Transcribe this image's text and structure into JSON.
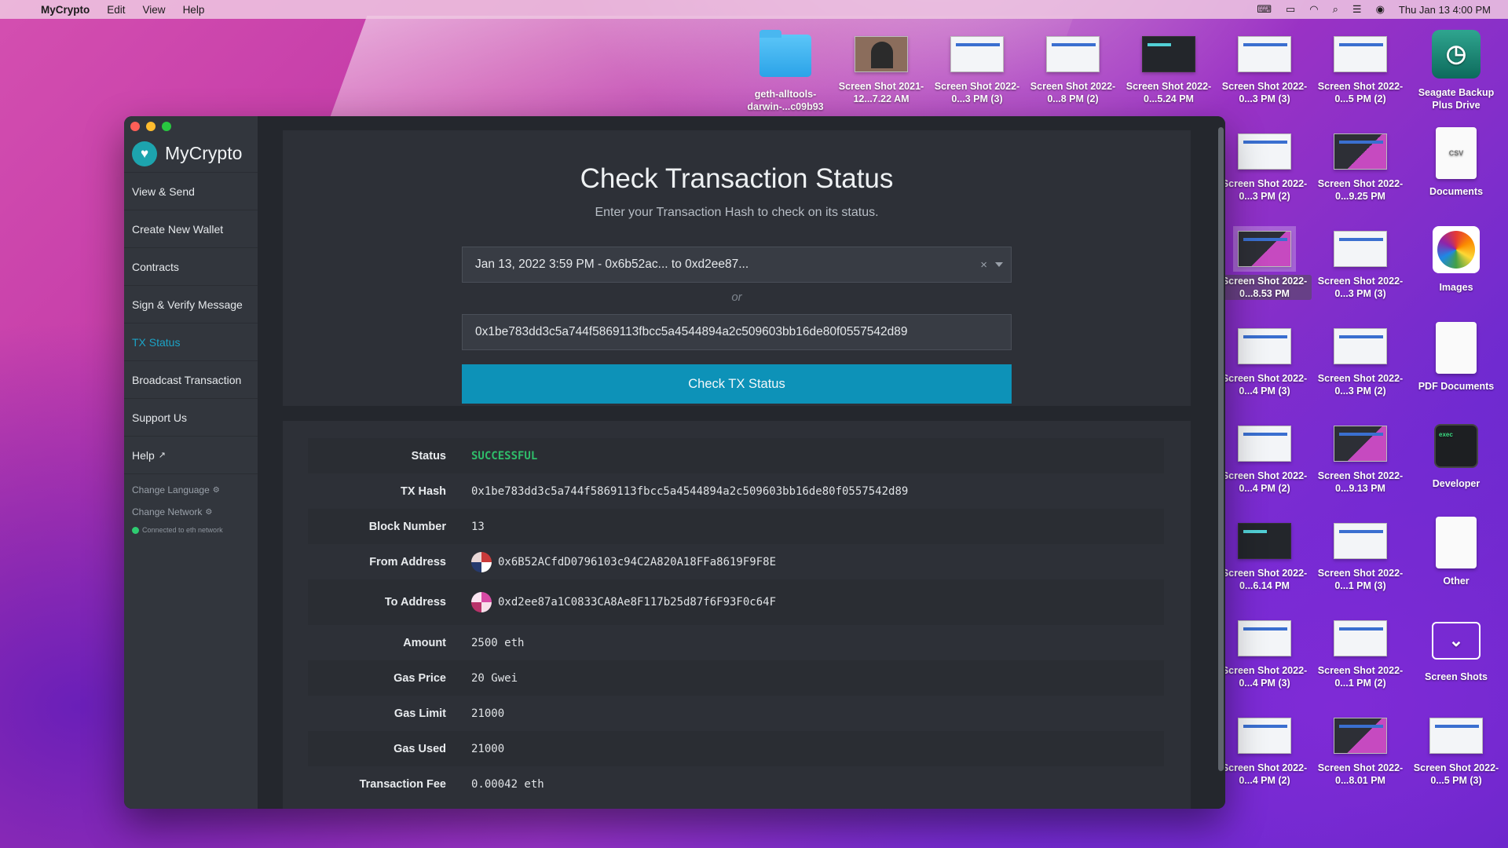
{
  "menubar": {
    "app_name": "MyCrypto",
    "menus": [
      "Edit",
      "View",
      "Help"
    ],
    "datetime": "Thu Jan 13  4:00 PM"
  },
  "desktop": {
    "row1": [
      "geth-alltools-darwin-...c09b93",
      "Screen Shot 2021-12...7.22 AM",
      "Screen Shot 2022-0...3 PM (3)",
      "Screen Shot 2022-0...8 PM (2)",
      "Screen Shot 2022-0...5.24 PM",
      "Screen Shot 2022-0...3 PM (3)",
      "Screen Shot 2022-0...5 PM (2)",
      "Seagate Backup Plus Drive"
    ],
    "col1": [
      "Screen Shot 2022-0...3 PM (2)",
      "Screen Shot 2022-0...8.53 PM",
      "Screen Shot 2022-0...4 PM (3)",
      "Screen Shot 2022-0...4 PM (2)",
      "Screen Shot 2022-0...6.14 PM",
      "Screen Shot 2022-0...4 PM (3)",
      "Screen Shot 2022-0...4 PM (2)"
    ],
    "col2": [
      "Screen Shot 2022-0...9.25 PM",
      "Screen Shot 2022-0...3 PM (3)",
      "Screen Shot 2022-0...3 PM (2)",
      "Screen Shot 2022-0...9.13 PM",
      "Screen Shot 2022-0...1 PM (3)",
      "Screen Shot 2022-0...1 PM (2)",
      "Screen Shot 2022-0...8.01 PM"
    ],
    "col3": [
      "Documents",
      "Images",
      "PDF Documents",
      "Developer",
      "Other",
      "Screen Shots",
      "Screen Shot 2022-0...5 PM (3)"
    ]
  },
  "sidebar": {
    "brand": "MyCrypto",
    "items": [
      "View & Send",
      "Create New Wallet",
      "Contracts",
      "Sign & Verify Message",
      "TX Status",
      "Broadcast Transaction",
      "Support Us",
      "Help"
    ],
    "change_language": "Change Language",
    "change_network": "Change Network",
    "connected": "Connected to eth network"
  },
  "check": {
    "title": "Check Transaction Status",
    "hint": "Enter your Transaction Hash to check on its status.",
    "selected_tx": "Jan 13, 2022 3:59 PM - 0x6b52ac... to 0xd2ee87...",
    "or": "or",
    "hash_value": "0x1be783dd3c5a744f5869113fbcc5a4544894a2c509603bb16de80f0557542d89",
    "button": "Check TX Status"
  },
  "details": {
    "status_label": "Status",
    "status": "SUCCESSFUL",
    "hash_label": "TX Hash",
    "hash": "0x1be783dd3c5a744f5869113fbcc5a4544894a2c509603bb16de80f0557542d89",
    "block_label": "Block Number",
    "block": "13",
    "from_label": "From Address",
    "from": "0x6B52ACfdD0796103c94C2A820A18FFa8619F9F8E",
    "to_label": "To Address",
    "to": "0xd2ee87a1C0833CA8Ae8F117b25d87f6F93F0c64F",
    "amount_label": "Amount",
    "amount": "2500 eth",
    "gas_price_label": "Gas Price",
    "gas_price": "20 Gwei",
    "gas_limit_label": "Gas Limit",
    "gas_limit": "21000",
    "gas_used_label": "Gas Used",
    "gas_used": "21000",
    "fee_label": "Transaction Fee",
    "fee": "0.00042 eth"
  },
  "colors": {
    "accent": "#0d92b8",
    "success": "#2fbd6a",
    "active_nav": "#1ba3c6"
  }
}
